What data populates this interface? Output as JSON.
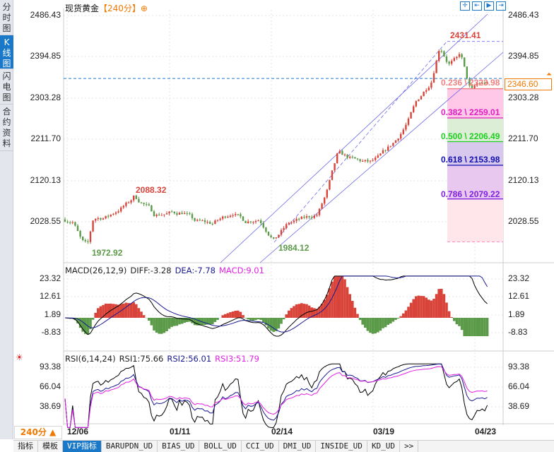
{
  "sidebar": {
    "tabs": [
      {
        "label": "分时图",
        "active": false
      },
      {
        "label": "K线图",
        "active": true
      },
      {
        "label": "闪电图",
        "active": false
      },
      {
        "label": "合约资料",
        "active": false
      }
    ]
  },
  "header": {
    "symbol": "现货黄金",
    "period": "【240分】",
    "toolbar_icons": [
      "crosshair-icon",
      "zoom-left-icon",
      "play-icon",
      "jump-end-icon"
    ]
  },
  "price_panel": {
    "axis_labels": [
      "2486.43",
      "2394.85",
      "2303.28",
      "2211.70",
      "2120.13",
      "2028.55"
    ],
    "current_price": "2346.60",
    "high_label": "2431.41",
    "high2_label": "2088.32",
    "low_label": "1972.92",
    "low2_label": "1984.12",
    "fib_levels": [
      {
        "text": "0.236 \\ 2323.98",
        "ratio": 0.236,
        "price": 2323.98,
        "color": "#f08080"
      },
      {
        "text": "0.382 \\ 2259.01",
        "ratio": 0.382,
        "price": 2259.01,
        "color": "#e020c0"
      },
      {
        "text": "0.500 \\ 2206.49",
        "ratio": 0.5,
        "price": 2206.49,
        "color": "#20d020"
      },
      {
        "text": "0.618 \\ 2153.98",
        "ratio": 0.618,
        "price": 2153.98,
        "color": "#1010b0"
      },
      {
        "text": "0.786 \\ 2079.22",
        "ratio": 0.786,
        "price": 2079.22,
        "color": "#8020e0"
      }
    ]
  },
  "macd_panel": {
    "name": "MACD(26,12,9)",
    "diff": "DIFF:-3.28",
    "dea": "DEA:-7.78",
    "macd": "MACD:9.01",
    "axis_labels": [
      "23.32",
      "12.61",
      "1.89",
      "-8.83"
    ]
  },
  "rsi_panel": {
    "name": "RSI(6,14,24)",
    "rsi1": "RSI1:75.66",
    "rsi2": "RSI2:56.01",
    "rsi3": "RSI3:51.79",
    "axis_labels": [
      "93.38",
      "66.04",
      "38.69"
    ]
  },
  "x_axis": {
    "period_button": "240分 ▲",
    "dates": [
      "12/06",
      "01/11",
      "02/14",
      "03/19",
      "04/23"
    ]
  },
  "bottom_tabs": [
    {
      "label": "指标"
    },
    {
      "label": "模板"
    },
    {
      "label": "VIP指标",
      "active": true
    },
    {
      "label": "BARUPDN_UD"
    },
    {
      "label": "BIAS_UD"
    },
    {
      "label": "BOLL_UD"
    },
    {
      "label": "CCI_UD"
    },
    {
      "label": "DMI_UD"
    },
    {
      "label": "INSIDE_UD"
    },
    {
      "label": "KD_UD"
    },
    {
      "label": ">>"
    }
  ],
  "colors": {
    "up": "#d9443a",
    "down": "#5a9a48",
    "accent": "#1a78c8",
    "period": "#f07800"
  },
  "chart_data": {
    "type": "candlestick",
    "ylim": [
      1960,
      2500
    ],
    "price_path": [
      [
        "12/04",
        2035
      ],
      [
        "12/08",
        2030
      ],
      [
        "12/11",
        1985
      ],
      [
        "12/13",
        1975
      ],
      [
        "12/15",
        2035
      ],
      [
        "12/20",
        2040
      ],
      [
        "12/27",
        2070
      ],
      [
        "12/29",
        2085
      ],
      [
        "01/03",
        2060
      ],
      [
        "01/05",
        2045
      ],
      [
        "01/15",
        2050
      ],
      [
        "01/19",
        2030
      ],
      [
        "01/25",
        2025
      ],
      [
        "02/01",
        2050
      ],
      [
        "02/05",
        2030
      ],
      [
        "02/10",
        2035
      ],
      [
        "02/15",
        1988
      ],
      [
        "02/20",
        2025
      ],
      [
        "03/01",
        2045
      ],
      [
        "03/04",
        2090
      ],
      [
        "03/08",
        2180
      ],
      [
        "03/14",
        2165
      ],
      [
        "03/19",
        2160
      ],
      [
        "03/22",
        2170
      ],
      [
        "03/28",
        2210
      ],
      [
        "04/01",
        2250
      ],
      [
        "04/04",
        2295
      ],
      [
        "04/09",
        2340
      ],
      [
        "04/12",
        2420
      ],
      [
        "04/15",
        2380
      ],
      [
        "04/18",
        2390
      ],
      [
        "04/19",
        2405
      ],
      [
        "04/22",
        2330
      ],
      [
        "04/23",
        2320
      ],
      [
        "04/25",
        2335
      ]
    ]
  }
}
